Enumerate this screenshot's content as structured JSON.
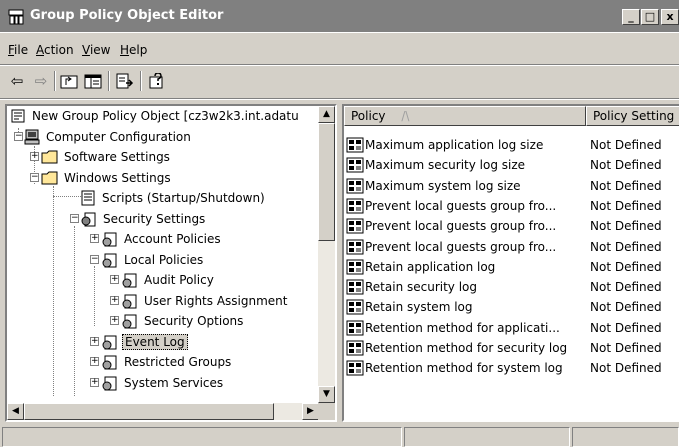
{
  "window": {
    "title": "Group Policy Object Editor",
    "min": "_",
    "max": "□",
    "close": "x"
  },
  "menu": [
    {
      "mnemonic": "F",
      "rest": "ile"
    },
    {
      "mnemonic": "A",
      "rest": "ction"
    },
    {
      "mnemonic": "V",
      "rest": "iew"
    },
    {
      "mnemonic": "H",
      "rest": "elp"
    }
  ],
  "toolbar": {
    "back": "⇦",
    "forward": "⇨",
    "icons": [
      "up-folder-icon",
      "show-hide-tree-icon",
      "export-list-icon",
      "help-icon"
    ]
  },
  "tree": {
    "root": "New Group Policy Object [cz3w2k3.int.adatu",
    "computer_config": "Computer Configuration",
    "software_settings": "Software Settings",
    "windows_settings": "Windows Settings",
    "scripts": "Scripts (Startup/Shutdown)",
    "security_settings": "Security Settings",
    "account_policies": "Account Policies",
    "local_policies": "Local Policies",
    "audit_policy": "Audit Policy",
    "user_rights": "User Rights Assignment",
    "security_options": "Security Options",
    "event_log": "Event Log",
    "restricted_groups": "Restricted Groups",
    "system_services": "System Services"
  },
  "list": {
    "columns": {
      "policy": "Policy",
      "sort_arrow": "/\\",
      "setting": "Policy Setting"
    },
    "rows": [
      {
        "policy": "Maximum application log size",
        "setting": "Not Defined"
      },
      {
        "policy": "Maximum security log size",
        "setting": "Not Defined"
      },
      {
        "policy": "Maximum system log size",
        "setting": "Not Defined"
      },
      {
        "policy": "Prevent local guests group fro...",
        "setting": "Not Defined"
      },
      {
        "policy": "Prevent local guests group fro...",
        "setting": "Not Defined"
      },
      {
        "policy": "Prevent local guests group fro...",
        "setting": "Not Defined"
      },
      {
        "policy": "Retain application log",
        "setting": "Not Defined"
      },
      {
        "policy": "Retain security log",
        "setting": "Not Defined"
      },
      {
        "policy": "Retain system log",
        "setting": "Not Defined"
      },
      {
        "policy": "Retention method for applicati...",
        "setting": "Not Defined"
      },
      {
        "policy": "Retention method for security log",
        "setting": "Not Defined"
      },
      {
        "policy": "Retention method for system log",
        "setting": "Not Defined"
      }
    ]
  },
  "colors": {
    "titlebar_inactive": "#808080",
    "face": "#d4d0c8",
    "folder": "#ffe79a",
    "pane_bg": "#ffffff"
  }
}
